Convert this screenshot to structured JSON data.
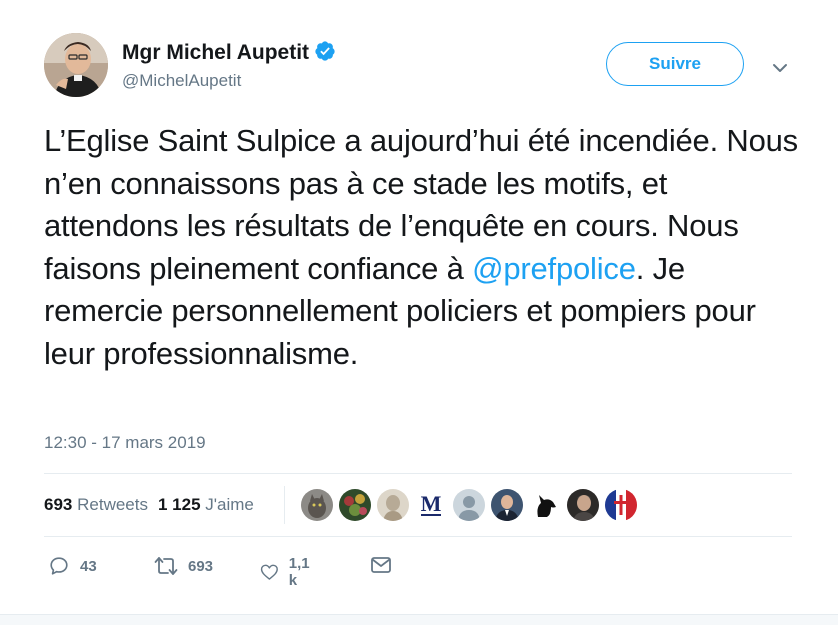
{
  "author": {
    "name": "Mgr Michel Aupetit",
    "handle": "@MichelAupetit",
    "verified": true,
    "avatar_icon": "profile-photo"
  },
  "follow_button": {
    "label": "Suivre"
  },
  "menu_icon": "chevron-down-icon",
  "tweet": {
    "text_before": "L’Eglise Saint Sulpice a aujourd’hui été incendiée. Nous n’en connaissons pas à ce stade les motifs, et attendons les résultats de l’enquête en cours. Nous faisons pleinement confiance à ",
    "mention": "@prefpolice",
    "text_after": ". Je remercie personnellement policiers et pompiers pour leur professionnalisme.",
    "timestamp": "12:30 - 17 mars 2019"
  },
  "stats": {
    "retweets_count": "693",
    "retweets_label": "Retweets",
    "likes_count": "1 125",
    "likes_label": "J'aime"
  },
  "liker_avatars": [
    "cat",
    "flowers",
    "statue",
    "letter-m",
    "default-user",
    "man-suit",
    "black-dog",
    "man-portrait",
    "flag-cross"
  ],
  "liker_letter": "M",
  "actions": {
    "replies": "43",
    "retweets": "693",
    "likes": "1,1 k"
  },
  "colors": {
    "accent": "#1da1f2",
    "secondary_text": "#657786",
    "primary_text": "#14171a"
  }
}
